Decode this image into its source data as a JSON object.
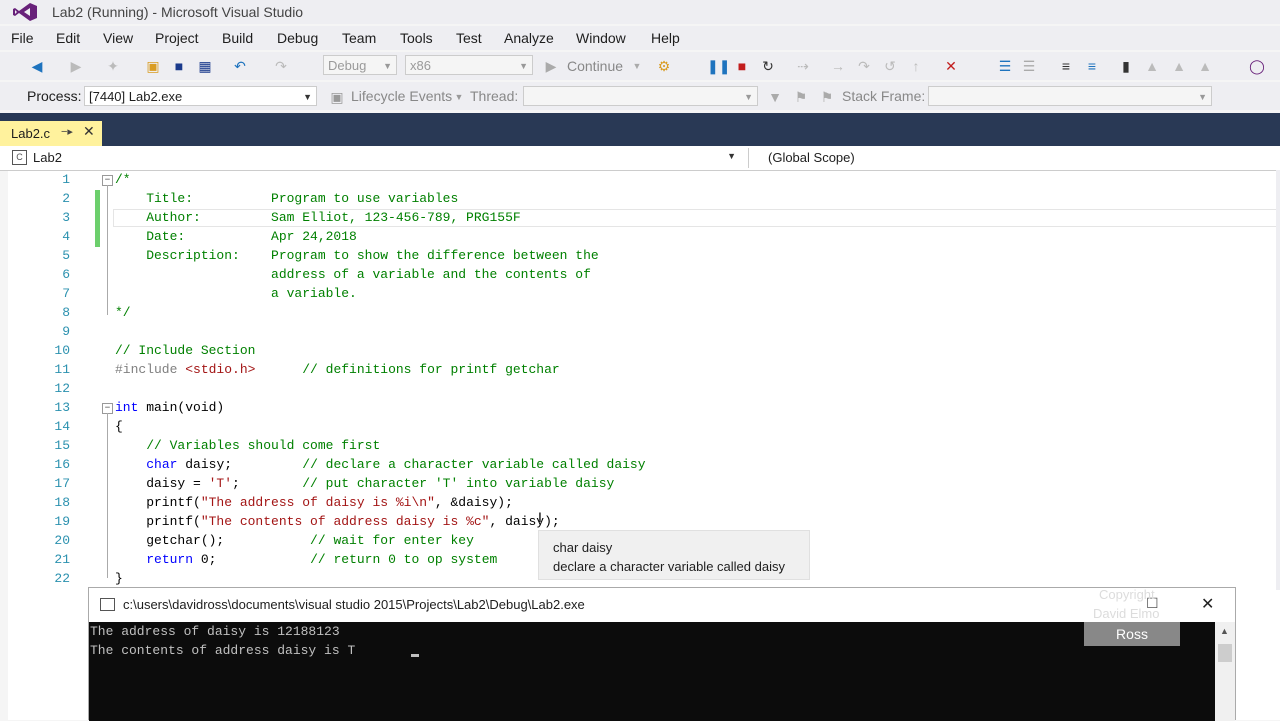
{
  "window": {
    "title": "Lab2 (Running) - Microsoft Visual Studio"
  },
  "menu": [
    "File",
    "Edit",
    "View",
    "Project",
    "Build",
    "Debug",
    "Team",
    "Tools",
    "Test",
    "Analyze",
    "Window",
    "Help"
  ],
  "toolbar": {
    "config": "Debug",
    "platform": "x86",
    "continue_label": "Continue"
  },
  "debug_toolbar": {
    "process_label": "Process:",
    "process_value": "[7440] Lab2.exe",
    "lifecycle_label": "Lifecycle Events",
    "thread_label": "Thread:",
    "stackframe_label": "Stack Frame:"
  },
  "tab": {
    "label": "Lab2.c"
  },
  "navbar": {
    "project": "Lab2",
    "scope": "(Global Scope)"
  },
  "code": {
    "line_numbers": [
      "1",
      "2",
      "3",
      "4",
      "5",
      "6",
      "7",
      "8",
      "9",
      "10",
      "11",
      "12",
      "13",
      "14",
      "15",
      "16",
      "17",
      "18",
      "19",
      "20",
      "21",
      "22"
    ],
    "l1": "/*",
    "l2": "    Title:          Program to use variables",
    "l3": "    Author:         Sam Elliot, 123-456-789, PRG155F",
    "l4": "    Date:           Apr 24,2018",
    "l5": "    Description:    Program to show the difference between the",
    "l6": "                    address of a variable and the contents of",
    "l7": "                    a variable.",
    "l8": "*/",
    "l10": "// Include Section",
    "l11_pp": "#include ",
    "l11_hdr": "<stdio.h>",
    "l11_gap": "      ",
    "l11_cmt": "// definitions for printf getchar",
    "l13_kw": "int",
    "l13_rest": " main(void)",
    "l14": "{",
    "l15": "    // Variables should come first",
    "l16_ind": "    ",
    "l16_kw": "char",
    "l16_rest": " daisy;         ",
    "l16_cmt": "// declare a character variable called daisy",
    "l17_a": "    daisy = ",
    "l17_str": "'T'",
    "l17_b": ";        ",
    "l17_cmt": "// put character 'T' into variable daisy",
    "l18_a": "    printf(",
    "l18_str": "\"The address of daisy is %i\\n\"",
    "l18_b": ", &daisy);",
    "l19_a": "    printf(",
    "l19_str": "\"The contents of address daisy is %c\"",
    "l19_b": ", daisy);",
    "l20_a": "    getchar();           ",
    "l20_cmt": "// wait for enter key",
    "l21_ind": "    ",
    "l21_kw": "return",
    "l21_b": " 0;            ",
    "l21_cmt": "// return 0 to op system",
    "l22": "}"
  },
  "tooltip": {
    "line1": "char daisy",
    "line2": "declare a character variable called daisy"
  },
  "console": {
    "title": "c:\\users\\davidross\\documents\\visual studio 2015\\Projects\\Lab2\\Debug\\Lab2.exe",
    "line1": "The address of daisy is 12188123",
    "line2": "The contents of address daisy is T"
  },
  "watermark": {
    "line1": "Copyright",
    "line2": "David Elmo",
    "badge": "Ross"
  },
  "colors": {
    "tabstrip": "#293955",
    "tab_active": "#fff29d",
    "comment": "#008000",
    "keyword": "#0000ff",
    "string": "#a31515",
    "line_number": "#2b91af"
  }
}
